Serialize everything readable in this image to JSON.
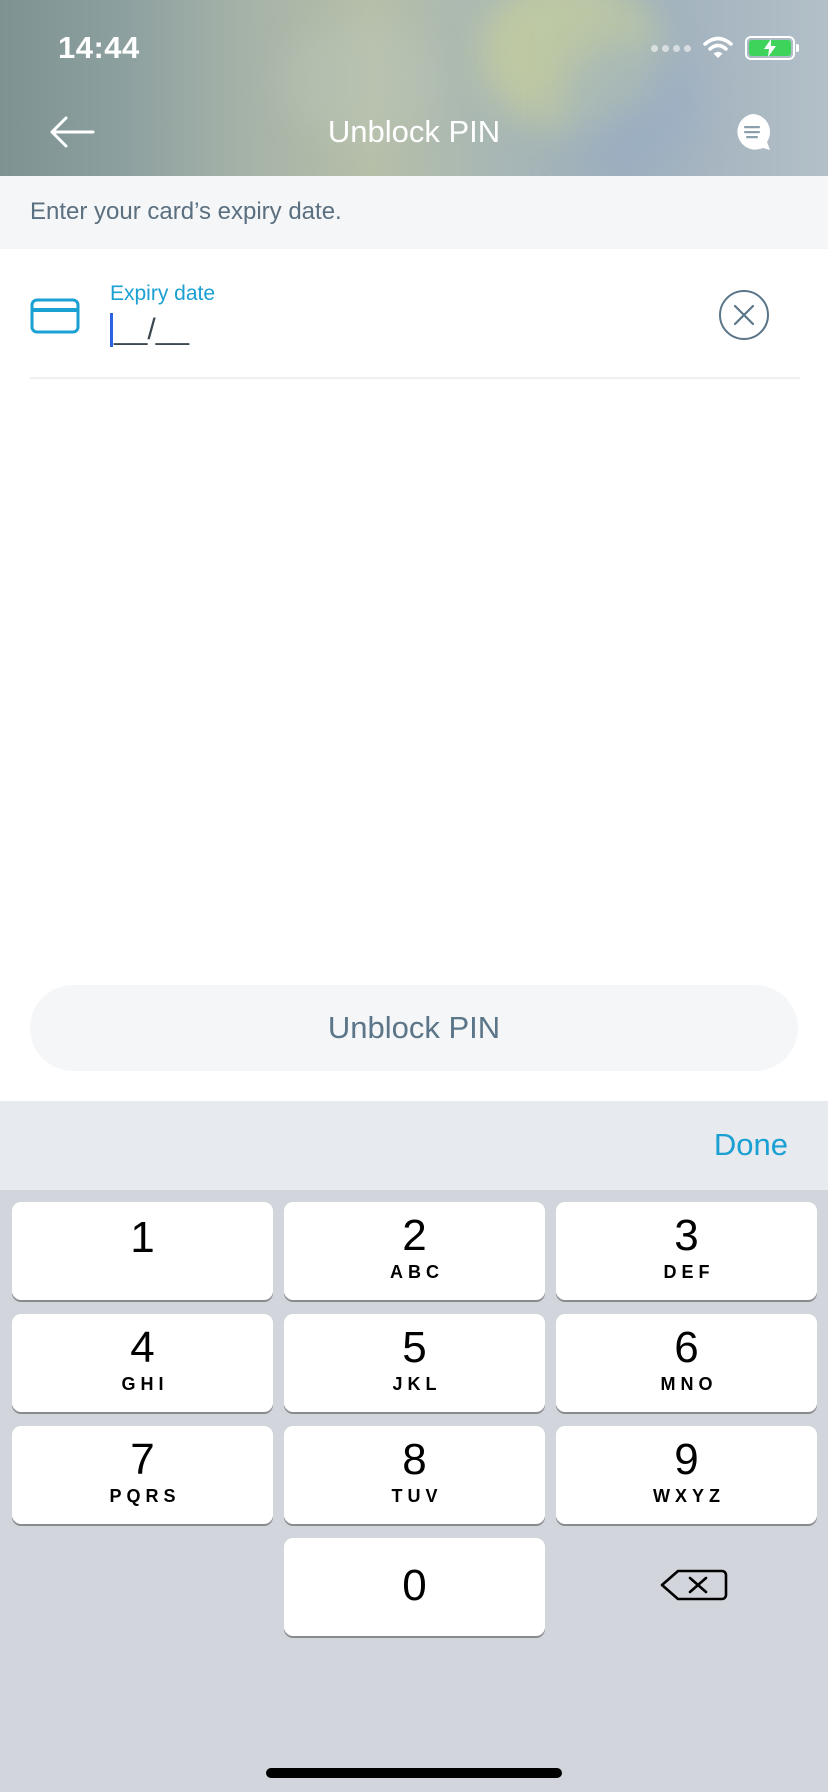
{
  "status_bar": {
    "time": "14:44"
  },
  "nav": {
    "title": "Unblock PIN",
    "back_icon": "arrow-left-icon",
    "chat_icon": "chat-bubble-icon"
  },
  "instruction": "Enter your card’s expiry date.",
  "expiry_field": {
    "label": "Expiry date",
    "value": "__/__",
    "card_icon": "credit-card-icon",
    "clear_icon": "clear-circle-icon"
  },
  "submit_button": {
    "label": "Unblock PIN"
  },
  "keyboard": {
    "done_label": "Done",
    "keys": [
      {
        "num": "1",
        "letters": ""
      },
      {
        "num": "2",
        "letters": "ABC"
      },
      {
        "num": "3",
        "letters": "DEF"
      },
      {
        "num": "4",
        "letters": "GHI"
      },
      {
        "num": "5",
        "letters": "JKL"
      },
      {
        "num": "6",
        "letters": "MNO"
      },
      {
        "num": "7",
        "letters": "PQRS"
      },
      {
        "num": "8",
        "letters": "TUV"
      },
      {
        "num": "9",
        "letters": "WXYZ"
      },
      {
        "num": "0",
        "letters": ""
      }
    ],
    "backspace_icon": "backspace-icon"
  },
  "colors": {
    "accent": "#1aa0d2",
    "caret": "#2b62e0",
    "muted_text": "#5a6f80",
    "battery": "#3ed35a"
  }
}
